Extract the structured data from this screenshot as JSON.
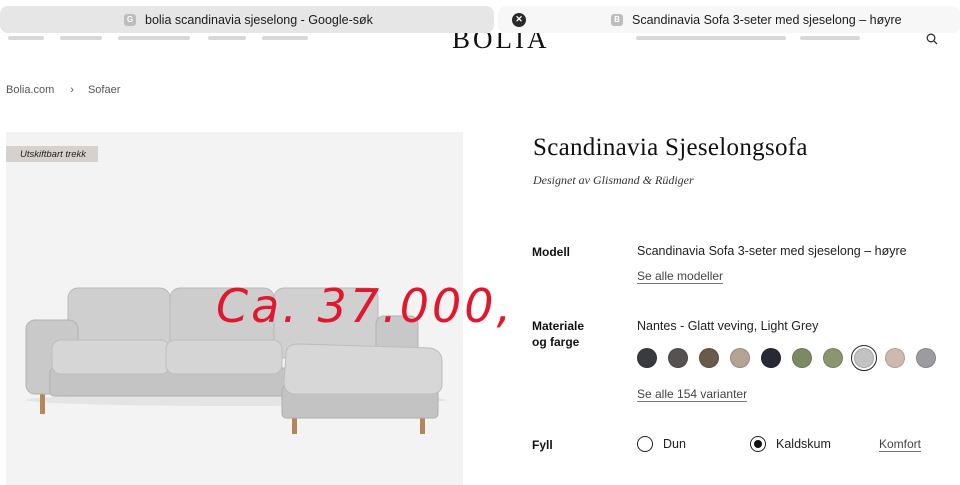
{
  "browser": {
    "tabs": [
      {
        "favicon": "G",
        "title": "bolia scandinavia sjeselong - Google-søk",
        "active": false
      },
      {
        "favicon": "B",
        "title": "Scandinavia Sofa 3-seter med sjeselong – høyre",
        "active": true
      }
    ]
  },
  "header": {
    "logo": "BOLIA"
  },
  "breadcrumb": [
    "Bolia.com",
    "Sofaer"
  ],
  "product": {
    "badge": "Utskiftbart trekk",
    "handwritten_note": "Ca. 37.000,-",
    "title": "Scandinavia Sjeselongsofa",
    "designer": "Designet av Glismand & Rüdiger",
    "model": {
      "label": "Modell",
      "value": "Scandinavia Sofa 3-seter med sjeselong – høyre",
      "link": "Se alle modeller"
    },
    "material": {
      "label_line1": "Materiale",
      "label_line2": "og farge",
      "value": "Nantes - Glatt veving, Light Grey",
      "link": "Se alle 154 varianter",
      "swatches": [
        {
          "color": "#3a3b3f",
          "selected": false
        },
        {
          "color": "#55524f",
          "selected": false
        },
        {
          "color": "#6a5a4c",
          "selected": false
        },
        {
          "color": "#b3a494",
          "selected": false
        },
        {
          "color": "#262a33",
          "selected": false
        },
        {
          "color": "#7b8a63",
          "selected": false
        },
        {
          "color": "#8b9571",
          "selected": false
        },
        {
          "color": "#c2c2c2",
          "selected": true
        },
        {
          "color": "#cdb9ad",
          "selected": false
        },
        {
          "color": "#9c9ca0",
          "selected": false
        }
      ]
    },
    "fill": {
      "label": "Fyll",
      "options": [
        {
          "label": "Dun",
          "selected": false
        },
        {
          "label": "Kaldskum",
          "selected": true
        }
      ],
      "link": "Komfort"
    }
  }
}
